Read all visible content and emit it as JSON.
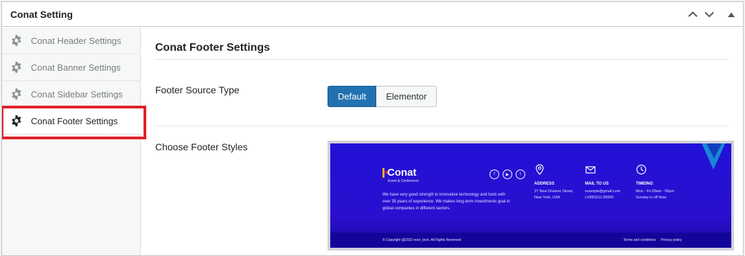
{
  "panel": {
    "title": "Conat Setting",
    "controls": [
      "chevron-up",
      "chevron-down",
      "collapse"
    ]
  },
  "sidebar": {
    "items": [
      {
        "label": "Conat Header Settings",
        "active": false
      },
      {
        "label": "Conat Banner Settings",
        "active": false
      },
      {
        "label": "Conat Sidebar Settings",
        "active": false
      },
      {
        "label": "Conat Footer Settings",
        "active": true
      }
    ]
  },
  "main": {
    "section_title": "Conat Footer Settings",
    "footer_source": {
      "label": "Footer Source Type",
      "options": [
        "Default",
        "Elementor"
      ],
      "selected": "Default"
    },
    "footer_styles": {
      "label": "Choose Footer Styles"
    }
  },
  "preview": {
    "logo_name": "Conat",
    "logo_tag": "Event & Conference",
    "description": "We have very good strength in innovative technology and tools with over 35 years of experience. We makes long-term investments goal in global companies in different sectors.",
    "social": [
      "f",
      "▶",
      "t"
    ],
    "address": {
      "title": "ADDRESS",
      "lines": [
        "27 New Division Street,",
        "New York, USA"
      ]
    },
    "mail": {
      "title": "MAIL TO US",
      "lines": [
        "example@gmail.com",
        "(+000)111-00000"
      ]
    },
    "timing": {
      "title": "TIMEING",
      "lines": [
        "Mon - Fri 09am - 06pm",
        "Sunday is off Now."
      ]
    },
    "copyright": "© Copyright @2023 noor_tech. All Rights Reserved",
    "links": [
      "Terms and conditions",
      "Privacy policy"
    ]
  },
  "colors": {
    "accent": "#2271b1",
    "highlight_border": "#e0222a",
    "preview_bg": "#2111d6"
  }
}
